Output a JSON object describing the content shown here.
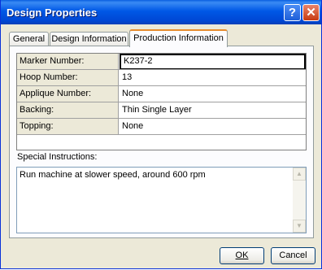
{
  "window": {
    "title": "Design Properties",
    "help_glyph": "?",
    "close_glyph": "✕"
  },
  "tabs": [
    {
      "label": "General"
    },
    {
      "label": "Design Information"
    },
    {
      "label": "Production Information",
      "active": true
    }
  ],
  "grid": {
    "rows": [
      {
        "label": "Marker Number:",
        "value": "K237-2"
      },
      {
        "label": "Hoop Number:",
        "value": "13"
      },
      {
        "label": "Applique Number:",
        "value": "None"
      },
      {
        "label": "Backing:",
        "value": "Thin Single Layer"
      },
      {
        "label": "Topping:",
        "value": "None"
      }
    ]
  },
  "special_instructions": {
    "label": "Special Instructions:",
    "value": "Run machine at slower speed, around 600 rpm"
  },
  "buttons": {
    "ok": "OK",
    "cancel": "Cancel"
  }
}
